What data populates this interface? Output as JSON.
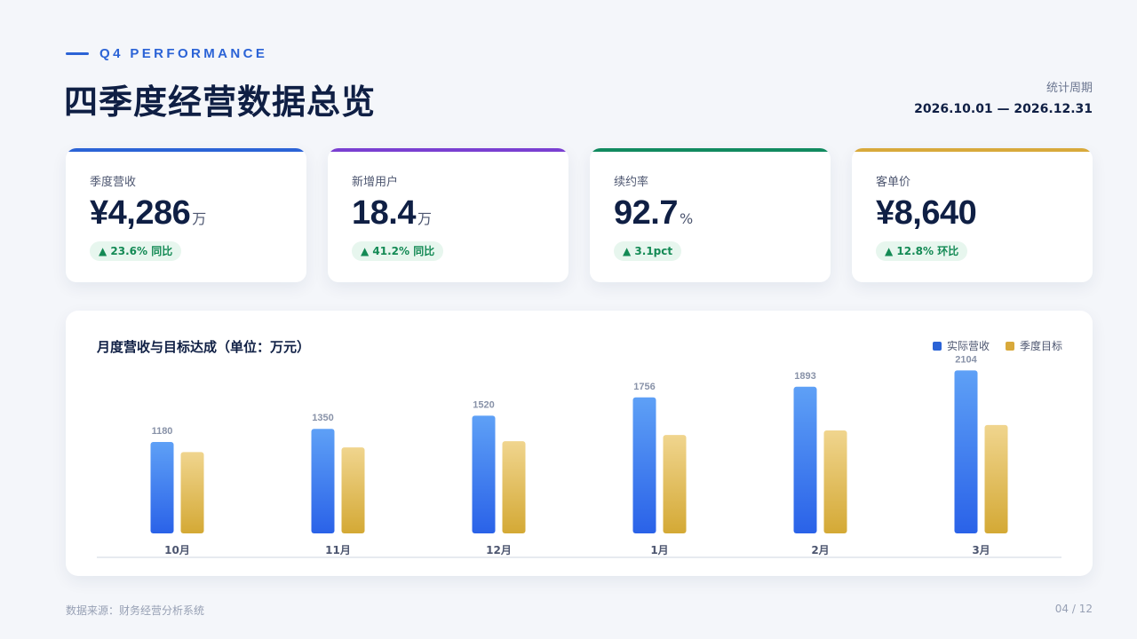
{
  "header": {
    "eyebrow": "Q4 PERFORMANCE",
    "title": "四季度经营数据总览",
    "period_label": "统计周期",
    "period_value": "2026.10.01 — 2026.12.31"
  },
  "kpis": [
    {
      "label": "季度营收",
      "value": "¥4,286",
      "unit": "万",
      "badge": "▲ 23.6% 同比",
      "accent": "#2b63d6"
    },
    {
      "label": "新增用户",
      "value": "18.4",
      "unit": "万",
      "badge": "▲ 41.2% 同比",
      "accent": "#7a3fd1"
    },
    {
      "label": "续约率",
      "value": "92.7",
      "unit": "%",
      "badge": "▲ 3.1pct",
      "accent": "#118a5f"
    },
    {
      "label": "客单价",
      "value": "¥8,640",
      "unit": "",
      "badge": "▲ 12.8% 环比",
      "accent": "#d8a93b"
    }
  ],
  "chart_data": {
    "type": "bar",
    "title": "月度营收与目标达成（单位：万元）",
    "categories": [
      "10月",
      "11月",
      "12月",
      "1月",
      "2月",
      "3月"
    ],
    "series": [
      {
        "name": "实际营收",
        "values": [
          1180,
          1350,
          1520,
          1756,
          1893,
          2104
        ],
        "color": "#2b63d6"
      },
      {
        "name": "季度目标",
        "values": [
          1050,
          1110,
          1190,
          1270,
          1330,
          1400
        ],
        "color": "#d8a93b"
      }
    ],
    "data_labels": [
      "1180",
      "1350",
      "1520",
      "1756",
      "1893",
      "2104"
    ],
    "ylim": [
      0,
      2120
    ],
    "legend_position": "top-right",
    "grid": false
  },
  "footer": {
    "source": "数据来源：财务经营分析系统",
    "page": "04 / 12"
  }
}
